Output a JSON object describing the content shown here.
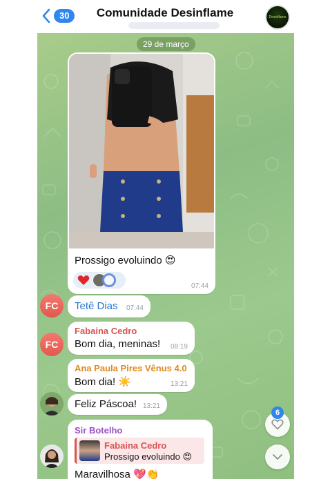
{
  "header": {
    "back_count": "30",
    "title": "Comunidade Desinflame",
    "avatar_logo_text": "Desinflame"
  },
  "chat": {
    "date_label": "29 de março",
    "messages": [
      {
        "type": "photo",
        "caption": "Prossigo evoluindo 😍",
        "time": "07:44",
        "reactions": [
          "❤️"
        ]
      },
      {
        "sender": "Tetê Dias",
        "initials": "FC",
        "text": "",
        "time": "07:44"
      },
      {
        "sender": "Fabaina Cedro",
        "initials": "FC",
        "text": "Bom dia, meninas!",
        "time": "08:19"
      },
      {
        "sender": "Ana Paula Pires Vênus 4.0",
        "text": "Bom dia! ☀️",
        "time": "13:21"
      },
      {
        "sender": "",
        "text": "Feliz Páscoa!",
        "time": "13:21"
      },
      {
        "sender": "Sir Botelho",
        "reply_sender": "Fabaina Cedro",
        "reply_text": "Prossigo evoluindo 😍",
        "text": "Maravilhosa 💖👏"
      }
    ]
  },
  "fab": {
    "reactions_count": "6"
  },
  "colors": {
    "accent": "#2f86f0",
    "chat_bg": "#9cc98d",
    "sender_tete": "#2b74c9",
    "sender_fabaina": "#d9534f",
    "sender_ana": "#e08a1e",
    "sender_sir": "#9b4fc9"
  },
  "icons": [
    "chevron-left-icon",
    "heart-icon",
    "chevron-down-icon"
  ]
}
